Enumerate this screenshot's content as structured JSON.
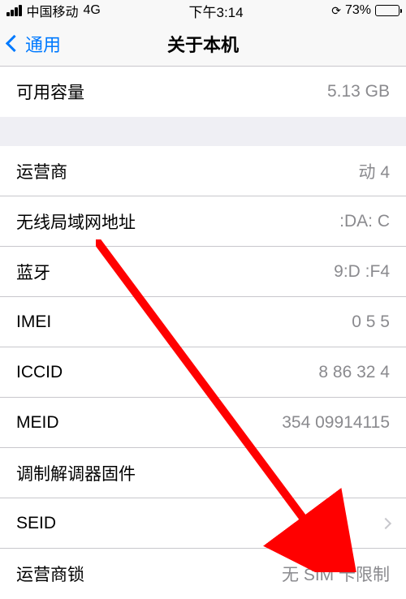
{
  "status": {
    "carrier": "中国移动",
    "network": "4G",
    "time": "下午3:14",
    "battery_pct": "73%"
  },
  "nav": {
    "back": "通用",
    "title": "关于本机"
  },
  "group1": {
    "available_label": "可用容量",
    "available_value": "5.13 GB"
  },
  "group2": {
    "carrier_label": "运营商",
    "carrier_value": "    动 4    ",
    "wlan_label": "无线局域网地址",
    "wlan_value": "   :DA:    C",
    "bt_label": "蓝牙",
    "bt_value": "   9:D    :F4",
    "imei_label": "IMEI",
    "imei_value": "   0       5 5",
    "iccid_label": "ICCID",
    "iccid_value": "8  86       32    4",
    "meid_label": "MEID",
    "meid_value": "354   09914115",
    "modem_label": "调制解调器固件",
    "modem_value": "",
    "seid_label": "SEID",
    "carrier_lock_label": "运营商锁",
    "carrier_lock_value": "无 SIM 卡限制"
  }
}
